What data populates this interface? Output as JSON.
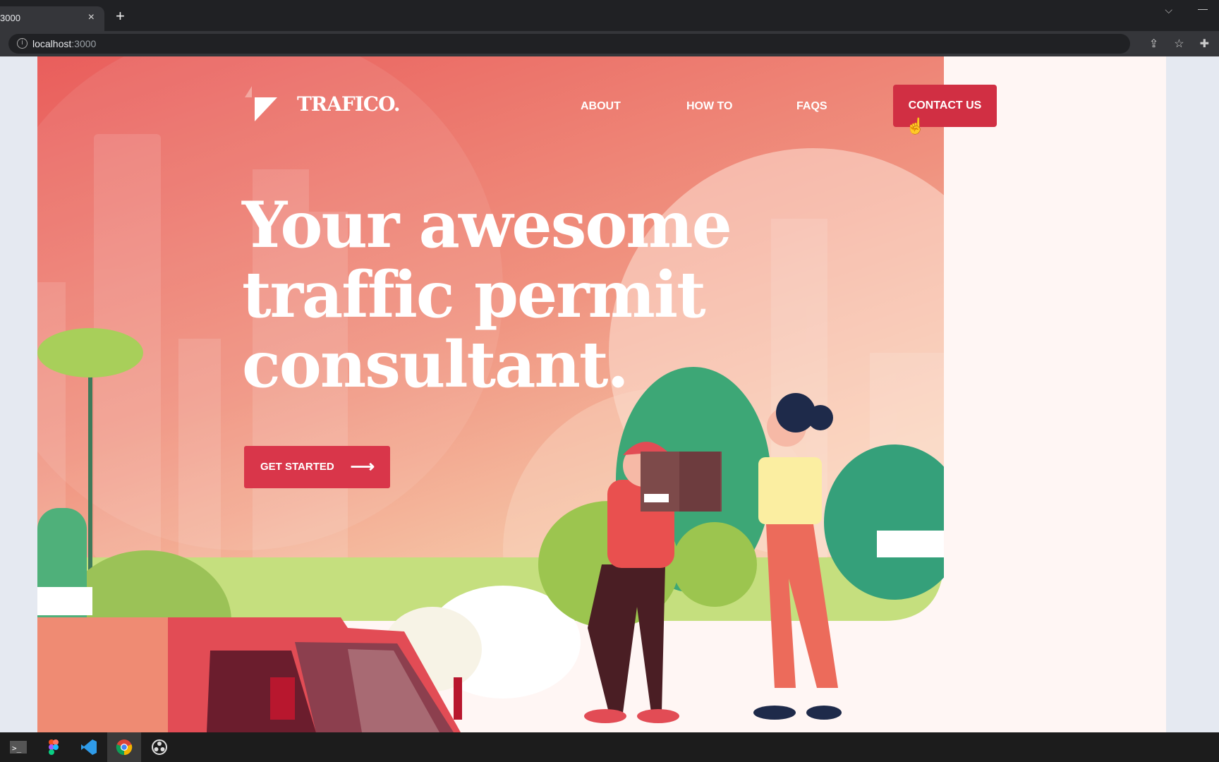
{
  "browser": {
    "tab_title": "3000",
    "close": "×",
    "new_tab": "+",
    "url_host": "localhost",
    "url_port": ":3000",
    "chevron": "⌵",
    "minimize": "—"
  },
  "site": {
    "logo": "TRAFICO.",
    "nav": [
      {
        "label": "ABOUT"
      },
      {
        "label": "HOW TO"
      },
      {
        "label": "FAQS"
      }
    ],
    "contact": "CONTACT US",
    "headline": [
      "Your awesome",
      "traffic permit",
      "consultant."
    ],
    "cta": "GET STARTED",
    "cta_arrow": "⟶"
  },
  "colors": {
    "accent": "#d12f43",
    "hero_top": "#e9645f",
    "hero_bottom": "#f3b59a",
    "cream": "#fff6f4"
  },
  "taskbar": [
    "terminal-icon",
    "figma-icon",
    "vscode-icon",
    "chrome-icon",
    "obs-icon"
  ]
}
